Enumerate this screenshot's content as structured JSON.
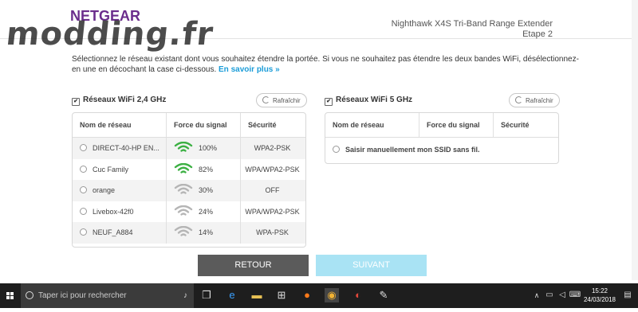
{
  "header": {
    "logo": "NETGEAR",
    "watermark": "modding.fr",
    "product": "Nighthawk X4S Tri-Band Range Extender",
    "step": "Etape 2"
  },
  "intro": {
    "text": "Sélectionnez le réseau existant dont vous souhaitez étendre la portée. Si vous ne souhaitez pas étendre les deux bandes WiFi, désélectionnez-en une en décochant la case ci-dessous.",
    "link": "En savoir plus »"
  },
  "band24": {
    "title": "Réseaux WiFi 2,4 GHz",
    "checked": true,
    "refresh_label": "Rafraîchir",
    "columns": [
      "Nom de réseau",
      "Force du signal",
      "Sécurité"
    ],
    "rows": [
      {
        "name": "DIRECT-40-HP EN...",
        "signal": "100%",
        "security": "WPA2-PSK",
        "signal_color": "#3cb043"
      },
      {
        "name": "Cuc Family",
        "signal": "82%",
        "security": "WPA/WPA2-PSK",
        "signal_color": "#3cb043"
      },
      {
        "name": "orange",
        "signal": "30%",
        "security": "OFF",
        "signal_color": "#b5b5b5"
      },
      {
        "name": "Livebox-42f0",
        "signal": "24%",
        "security": "WPA/WPA2-PSK",
        "signal_color": "#b5b5b5"
      },
      {
        "name": "NEUF_A884",
        "signal": "14%",
        "security": "WPA-PSK",
        "signal_color": "#b5b5b5"
      }
    ]
  },
  "band5": {
    "title": "Réseaux WiFi 5 GHz",
    "checked": true,
    "refresh_label": "Rafraîchir",
    "columns": [
      "Nom de réseau",
      "Force du signal",
      "Sécurité"
    ],
    "manual_label": "Saisir manuellement mon SSID sans fil."
  },
  "buttons": {
    "back": "RETOUR",
    "next": "SUIVANT",
    "back_color": "#5b5b5b",
    "next_color": "#a9e3f4"
  },
  "taskbar": {
    "search_placeholder": "Taper ici pour rechercher",
    "time": "15:22",
    "date": "24/03/2018"
  }
}
